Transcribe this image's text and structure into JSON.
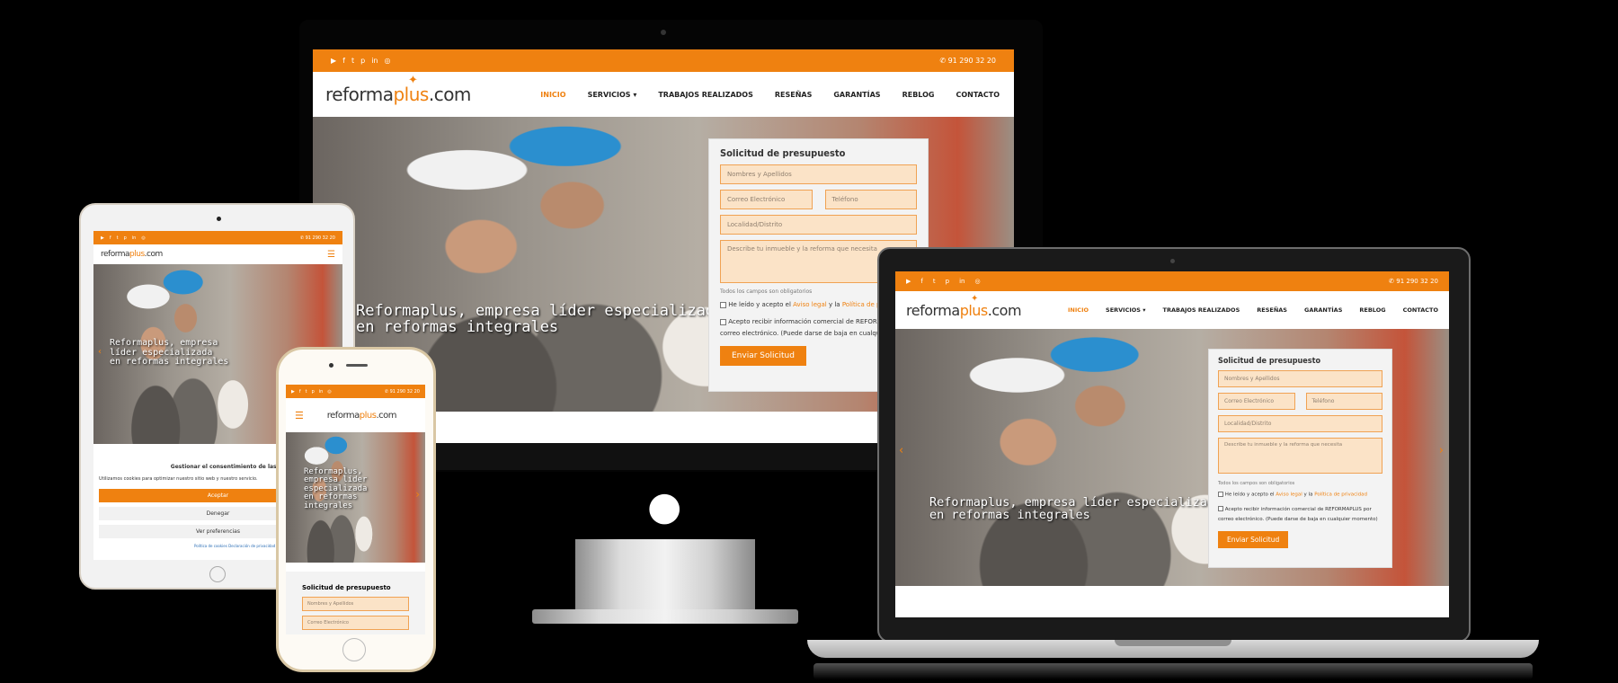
{
  "site": {
    "phone": "91 290 32 20",
    "logo_a": "reforma",
    "logo_b": "plus",
    "logo_c": ".com",
    "social_icons": [
      "youtube-icon",
      "facebook-icon",
      "twitter-icon",
      "pinterest-icon",
      "linkedin-icon",
      "instagram-icon"
    ],
    "nav": [
      "INICIO",
      "SERVICIOS",
      "TRABAJOS REALIZADOS",
      "RESEÑAS",
      "GARANTÍAS",
      "REBLOG",
      "CONTACTO"
    ],
    "hero_line1": "Reformaplus, empresa líder especializada",
    "hero_line2": "en reformas integrales",
    "form": {
      "title": "Solicitud de presupuesto",
      "name_ph": "Nombres y Apellidos",
      "email_ph": "Correo Electrónico",
      "phone_ph": "Teléfono",
      "locality_ph": "Localidad/Distrito",
      "message_ph": "Describe tu inmueble y la reforma que necesita",
      "required_note": "Todos los campos son obligatorios",
      "legal_prefix": "He leído y acepto el",
      "legal_link1": "Aviso legal",
      "legal_and": "y la",
      "legal_link2": "Política de privacidad",
      "consent_text": "Acepto recibir información comercial de REFORMAPLUS por",
      "consent_text2": "correo electrónico. (Puede darse de baja en cualquier momento)",
      "submit": "Enviar Solicitud"
    },
    "cookie": {
      "title": "Gestionar el consentimiento de las cookies",
      "text": "Utilizamos cookies para optimizar nuestro sitio web y nuestro servicio.",
      "accept": "Aceptar",
      "deny": "Denegar",
      "prefs": "Ver preferencias",
      "footer_links": "Política de cookies   Declaración de privacidad   Aviso legal"
    },
    "phone_caption": [
      "Reformaplus,",
      "empresa líder",
      "especializada",
      "en reformas",
      "integrales"
    ]
  },
  "colors": {
    "accent": "#ef8110",
    "field_bg": "#fbe3c7"
  }
}
